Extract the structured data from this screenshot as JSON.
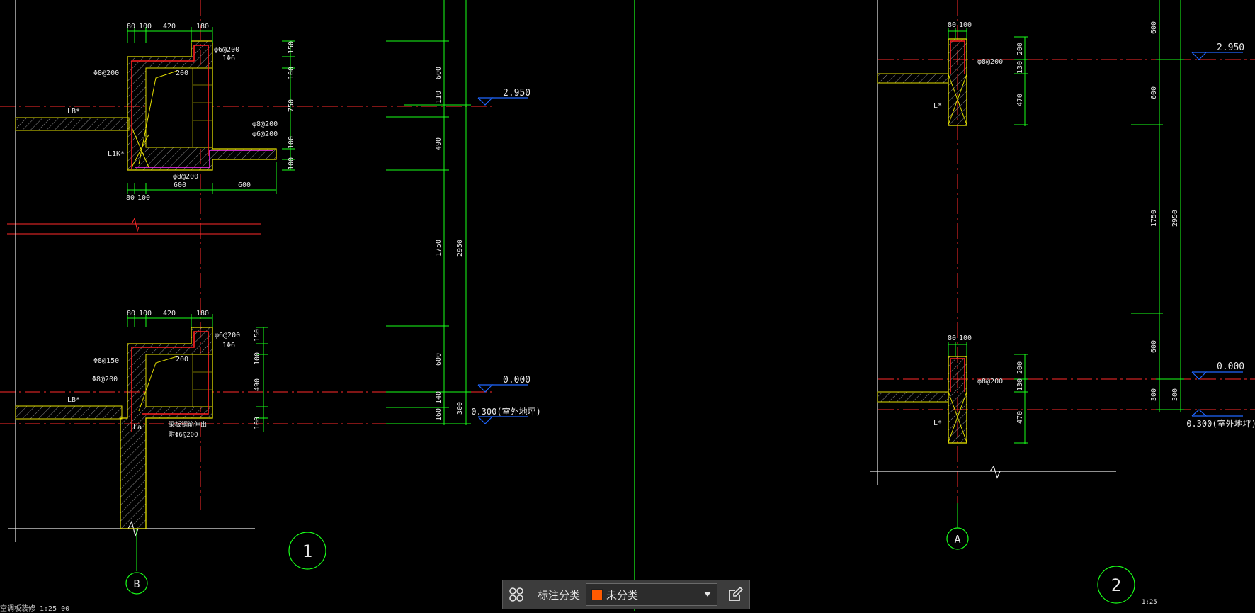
{
  "colors": {
    "background": "#000000",
    "axis_red": "#ff2a2a",
    "dim_green": "#19ff19",
    "level_blue": "#1f66ff",
    "outline_yellow": "#e5e000",
    "rebar_red": "#ff2020",
    "magenta": "#ff33ff",
    "text_white": "#e8e8e8",
    "swatch_orange": "#ff5a00"
  },
  "section1": {
    "top_dims": [
      "80",
      "100",
      "420",
      "180"
    ],
    "bottom_dims": [
      "80",
      "100",
      "600",
      "600"
    ],
    "right_dims": [
      "150",
      "100",
      "750",
      "100",
      "100"
    ],
    "rebar_labels": [
      "φ6@200",
      "1Φ6",
      "Φ8@200",
      "200",
      "φ8@200",
      "φ6@200",
      "φ8@200"
    ],
    "lb_label": "LB*",
    "l1k_label": "L1K*"
  },
  "section1_lower": {
    "top_dims": [
      "80",
      "100",
      "420",
      "180"
    ],
    "right_dims": [
      "150",
      "100",
      "490",
      "100"
    ],
    "rebar_labels": [
      "φ6@200",
      "1Φ6",
      "Φ8@150",
      "Φ8@200",
      "200",
      "梁板钢筋伸出",
      "附Φ6@200"
    ],
    "lb_label": "LB*",
    "la_label": "La"
  },
  "elevation1": {
    "dims_left": [
      "600",
      "110",
      "490",
      "1750",
      "600",
      "140",
      "160"
    ],
    "dims_total": [
      "2950",
      "300"
    ],
    "levels": [
      "2.950",
      "0.000",
      "-0.300(室外地坪)"
    ]
  },
  "section2": {
    "top_dims": [
      "80",
      "100"
    ],
    "right_dims": [
      "200",
      "130",
      "470"
    ],
    "rebar_label": "φ8@200",
    "l_label": "L*"
  },
  "section2_lower": {
    "top_dims": [
      "80",
      "100"
    ],
    "right_dims": [
      "200",
      "130",
      "470"
    ],
    "rebar_label": "φ8@200",
    "l_label": "L*"
  },
  "elevation2": {
    "dims_left": [
      "600",
      "600",
      "1750",
      "600",
      "300"
    ],
    "dims_total": [
      "2950",
      "300"
    ],
    "levels": [
      "2.950",
      "0.000",
      "-0.300(室外地坪)"
    ]
  },
  "axis_bubbles": [
    "B",
    "A"
  ],
  "detail_numbers": [
    "1",
    "2"
  ],
  "scale_label": "1:25",
  "bottom_caption": "空调板装修 1:25 00",
  "toolbar": {
    "grid_icon": "grid-icon",
    "label": "标注分类",
    "selected": "未分类",
    "dropdown_icon": "caret-down-icon",
    "edit_icon": "edit-icon"
  }
}
